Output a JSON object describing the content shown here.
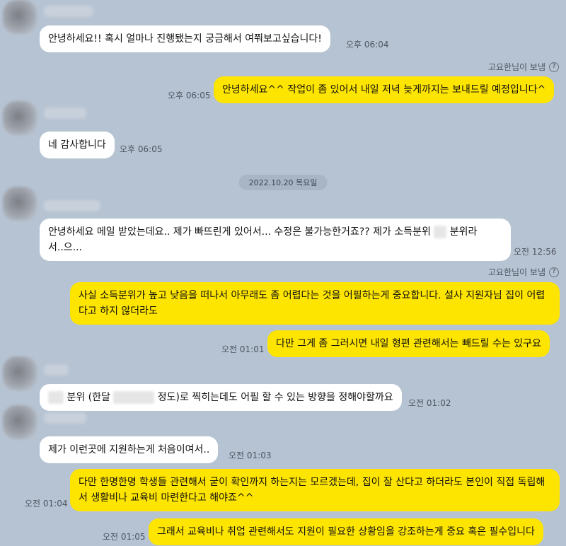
{
  "messages": {
    "m1": {
      "text": "안녕하세요!! 혹시 얼마나 진행됐는지 궁금해서 여쭤보고싶습니다!",
      "time": "오후 06:04"
    },
    "sender1": "고요한님이 보냄",
    "m2": {
      "text": "안녕하세요^^ 작업이 좀 있어서 내일 저녁 늦게까지는 보내드릴 예정입니다^",
      "time": "오후 06:05"
    },
    "m3": {
      "text": "네 감사합니다",
      "time": "오후 06:05"
    },
    "date_divider": "2022.10.20 목요일",
    "m4": {
      "text_a": "안녕하세요 메일 받았는데요.. 제가 빠뜨린게 있어서... 수정은 불가능한거죠?? 제가 소득분위",
      "text_b": "분위라",
      "text_c": "서..으...",
      "time": "오전 12:56"
    },
    "sender2": "고요한님이 보냄",
    "m5": {
      "text": "사실 소득분위가 높고 낮음을 떠나서 아무래도 좀 어렵다는 것을 어필하는게 중요합니다. 설사 지원자님 집이 어렵다고 하지 않더라도"
    },
    "m6": {
      "text": "다만 그게 좀 그러시면 내일 형편 관련해서는 빼드릴 수는 있구요",
      "time": "오전 01:01"
    },
    "m7": {
      "text_a": "분위 (한달",
      "text_b": "정도)로 찍히는데도 어필 할 수 있는 방향을 정해야할까요",
      "time": "오전 01:02"
    },
    "m8": {
      "text": "제가 이런곳에 지원하는게 처음이여서..",
      "time": "오전 01:03"
    },
    "m9": {
      "text": "다만 한명한명 학생들 관련해서 굳이 확인까지 하는지는 모르겠는데, 집이 잘 산다고 하더라도 본인이 직접 독립해서 생활비나 교육비 마련한다고 해야죠^^",
      "time": "오전 01:04"
    },
    "m10": {
      "text": "그래서 교육비나 취업 관련해서도 지원이 필요한 상황임을 강조하는게 중요 혹은 필수입니다",
      "time": "오전 01:05"
    }
  },
  "icons": {
    "help": "help-circle-icon",
    "help_glyph": "?"
  },
  "colors": {
    "background": "#b6c3d2",
    "incoming": "#ffffff",
    "outgoing": "#fee500"
  }
}
